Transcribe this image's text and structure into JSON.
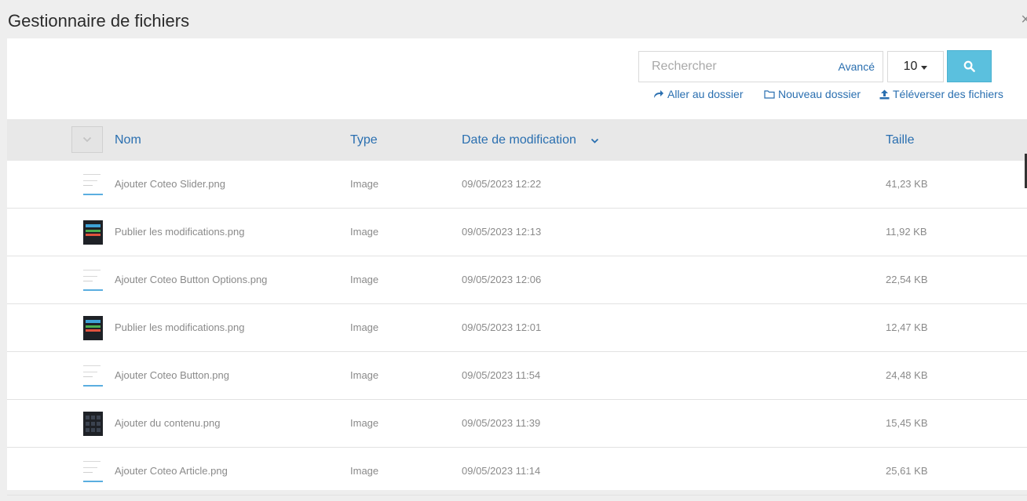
{
  "window": {
    "title": "Gestionnaire de fichiers",
    "close_glyph": "×"
  },
  "toolbar": {
    "search_placeholder": "Rechercher",
    "advanced_label": "Avancé",
    "per_page_value": "10",
    "search_icon": "search-icon",
    "goto_folder_label": "Aller au dossier",
    "new_folder_label": "Nouveau dossier",
    "upload_label": "Téléverser des fichiers"
  },
  "table": {
    "columns": {
      "name": "Nom",
      "type": "Type",
      "modified": "Date de modification",
      "size": "Taille"
    },
    "sorted_by": "Date de modification",
    "rows": [
      {
        "thumb": "doc",
        "name": "Ajouter Coteo Slider.png",
        "type": "Image",
        "modified": "09/05/2023 12:22",
        "size": "41,23 KB"
      },
      {
        "thumb": "dark",
        "name": "Publier les modifications.png",
        "type": "Image",
        "modified": "09/05/2023 12:13",
        "size": "11,92 KB"
      },
      {
        "thumb": "doc",
        "name": "Ajouter Coteo Button Options.png",
        "type": "Image",
        "modified": "09/05/2023 12:06",
        "size": "22,54 KB"
      },
      {
        "thumb": "dark",
        "name": "Publier les modifications.png",
        "type": "Image",
        "modified": "09/05/2023 12:01",
        "size": "12,47 KB"
      },
      {
        "thumb": "doc",
        "name": "Ajouter Coteo Button.png",
        "type": "Image",
        "modified": "09/05/2023 11:54",
        "size": "24,48 KB"
      },
      {
        "thumb": "grid",
        "name": "Ajouter du contenu.png",
        "type": "Image",
        "modified": "09/05/2023 11:39",
        "size": "15,45 KB"
      },
      {
        "thumb": "doc",
        "name": "Ajouter Coteo Article.png",
        "type": "Image",
        "modified": "09/05/2023 11:14",
        "size": "25,61 KB"
      }
    ]
  },
  "colors": {
    "accent": "#2a6fb0",
    "search_button": "#5bc0de",
    "header_bg": "#e8e8e8"
  }
}
